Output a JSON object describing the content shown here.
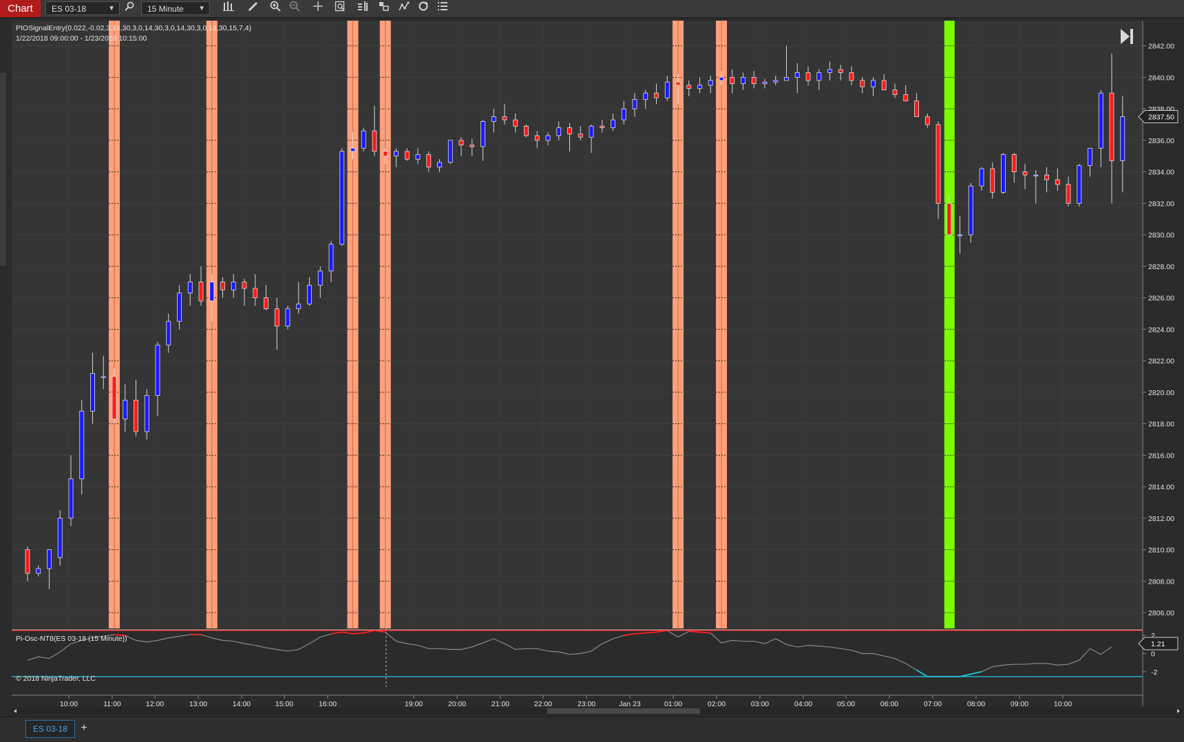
{
  "toolbar": {
    "chart_label": "Chart",
    "instrument": "ES 03-18",
    "interval": "15 Minute",
    "icons": [
      "search-icon",
      "bar-type-icon",
      "draw-pencil-icon",
      "zoom-in-icon",
      "zoom-out-icon",
      "crosshair-icon",
      "data-box-icon",
      "chart-trader-icon",
      "indicators-icon",
      "strategies-icon",
      "reload-icon",
      "properties-icon"
    ]
  },
  "chart": {
    "indicator_label": "PIOSignalEntry(0.022,-0.02,3,14,30,3,0,14,30,3,0,14,30,3,0,14,30,15,7,4)",
    "date_range": "1/22/2018 09:00:00 - 1/23/2018 10:15:00",
    "osc_label": "Pi-Osc-NT8(ES 03-18 (15 Minute))",
    "copyright": "© 2018 NinjaTrader, LLC",
    "current_price": "2837.50",
    "osc_value": "1.21",
    "colors": {
      "up": "#1a1aff",
      "down": "#ff1a1a",
      "short_band": "#ffa07a",
      "long_band": "#7cfc00",
      "osc_top": "#ff2020",
      "osc_bottom": "#22c8e6",
      "osc_line": "#8a8a8a"
    }
  },
  "tabs": {
    "active": "ES 03-18",
    "add": "+"
  },
  "chart_data": {
    "type": "candlestick",
    "price_axis": {
      "range": [
        2805,
        2843.6
      ],
      "ticks": [
        "2806.00",
        "2808.00",
        "2810.00",
        "2812.00",
        "2814.00",
        "2816.00",
        "2818.00",
        "2820.00",
        "2822.00",
        "2824.00",
        "2826.00",
        "2828.00",
        "2830.00",
        "2832.00",
        "2834.00",
        "2836.00",
        "2838.00",
        "2840.00",
        "2842.00"
      ]
    },
    "osc_axis": {
      "ticks": [
        "2",
        "0",
        "-2"
      ]
    },
    "time_ticks": [
      "10:00",
      "11:00",
      "12:00",
      "13:00",
      "14:00",
      "15:00",
      "16:00",
      "19:00",
      "20:00",
      "21:00",
      "22:00",
      "23:00",
      "Jan 23",
      "01:00",
      "02:00",
      "03:00",
      "04:00",
      "05:00",
      "06:00",
      "07:00",
      "08:00",
      "09:00",
      "10:00"
    ],
    "candles": [
      [
        2810.0,
        2810.2,
        2808.0,
        2808.5
      ],
      [
        2808.5,
        2809.0,
        2808.3,
        2808.8
      ],
      [
        2808.8,
        2810.0,
        2807.5,
        2810.0
      ],
      [
        2809.5,
        2812.5,
        2809.0,
        2812.0
      ],
      [
        2812.0,
        2816.0,
        2811.5,
        2814.5
      ],
      [
        2814.5,
        2819.5,
        2813.5,
        2818.8
      ],
      [
        2818.8,
        2822.5,
        2818.0,
        2821.2
      ],
      [
        2821.0,
        2822.3,
        2820.2,
        2821.0
      ],
      [
        2821.0,
        2821.5,
        2818.0,
        2818.3
      ],
      [
        2818.3,
        2820.5,
        2817.5,
        2819.5
      ],
      [
        2819.5,
        2820.8,
        2817.2,
        2817.5
      ],
      [
        2817.5,
        2820.2,
        2817.0,
        2819.8
      ],
      [
        2819.8,
        2823.2,
        2818.5,
        2823.0
      ],
      [
        2823.0,
        2825.0,
        2822.5,
        2824.5
      ],
      [
        2824.5,
        2826.8,
        2824.0,
        2826.3
      ],
      [
        2826.3,
        2827.5,
        2825.5,
        2827.0
      ],
      [
        2827.0,
        2828.0,
        2825.5,
        2825.8
      ],
      [
        2825.8,
        2827.5,
        2824.5,
        2827.0
      ],
      [
        2827.0,
        2827.3,
        2826.0,
        2826.5
      ],
      [
        2826.5,
        2827.5,
        2826.0,
        2827.0
      ],
      [
        2827.0,
        2827.2,
        2825.5,
        2826.6
      ],
      [
        2826.6,
        2827.5,
        2825.5,
        2826.0
      ],
      [
        2826.0,
        2826.8,
        2825.2,
        2825.3
      ],
      [
        2825.3,
        2826.0,
        2822.7,
        2824.2
      ],
      [
        2824.2,
        2825.5,
        2824.0,
        2825.3
      ],
      [
        2825.3,
        2827.0,
        2825.0,
        2825.6
      ],
      [
        2825.6,
        2827.3,
        2825.5,
        2826.8
      ],
      [
        2826.8,
        2828.0,
        2826.0,
        2827.7
      ],
      [
        2827.7,
        2829.6,
        2827.0,
        2829.4
      ],
      [
        2829.4,
        2835.5,
        2829.3,
        2835.3
      ],
      [
        2835.3,
        2836.5,
        2834.8,
        2835.5
      ],
      [
        2835.5,
        2836.8,
        2835.3,
        2836.6
      ],
      [
        2836.6,
        2838.2,
        2835.0,
        2835.3
      ],
      [
        2835.3,
        2835.5,
        2834.5,
        2835.0
      ],
      [
        2835.0,
        2835.5,
        2834.3,
        2835.3
      ],
      [
        2835.3,
        2835.5,
        2834.7,
        2834.8
      ],
      [
        2834.8,
        2835.5,
        2834.5,
        2835.1
      ],
      [
        2835.1,
        2835.3,
        2834.0,
        2834.3
      ],
      [
        2834.3,
        2834.8,
        2834.0,
        2834.6
      ],
      [
        2834.6,
        2836.0,
        2834.5,
        2836.0
      ],
      [
        2836.0,
        2836.2,
        2835.0,
        2835.7
      ],
      [
        2835.7,
        2836.1,
        2835.0,
        2835.6
      ],
      [
        2835.6,
        2837.3,
        2834.7,
        2837.2
      ],
      [
        2837.2,
        2838.0,
        2836.5,
        2837.5
      ],
      [
        2837.5,
        2838.3,
        2837.0,
        2837.3
      ],
      [
        2837.3,
        2837.7,
        2836.5,
        2836.9
      ],
      [
        2836.9,
        2837.0,
        2836.2,
        2836.3
      ],
      [
        2836.3,
        2836.6,
        2835.5,
        2836.0
      ],
      [
        2836.0,
        2836.5,
        2835.7,
        2836.3
      ],
      [
        2836.3,
        2837.2,
        2836.0,
        2836.8
      ],
      [
        2836.8,
        2837.1,
        2835.3,
        2836.4
      ],
      [
        2836.4,
        2836.9,
        2836.0,
        2836.2
      ],
      [
        2836.2,
        2837.0,
        2835.2,
        2836.9
      ],
      [
        2836.9,
        2837.3,
        2836.5,
        2836.8
      ],
      [
        2836.8,
        2837.7,
        2836.6,
        2837.3
      ],
      [
        2837.3,
        2838.5,
        2837.0,
        2838.0
      ],
      [
        2838.0,
        2839.0,
        2837.5,
        2838.6
      ],
      [
        2838.6,
        2839.2,
        2838.0,
        2839.0
      ],
      [
        2839.0,
        2839.6,
        2838.3,
        2838.7
      ],
      [
        2838.7,
        2840.1,
        2838.5,
        2839.7
      ],
      [
        2839.7,
        2840.2,
        2838.3,
        2839.5
      ],
      [
        2839.5,
        2839.8,
        2838.8,
        2839.3
      ],
      [
        2839.3,
        2840.0,
        2839.0,
        2839.5
      ],
      [
        2839.5,
        2840.1,
        2839.0,
        2839.8
      ],
      [
        2839.8,
        2840.4,
        2839.5,
        2840.0
      ],
      [
        2840.0,
        2840.5,
        2839.0,
        2839.6
      ],
      [
        2839.6,
        2840.3,
        2839.2,
        2840.0
      ],
      [
        2840.0,
        2840.4,
        2839.3,
        2839.6
      ],
      [
        2839.6,
        2839.9,
        2839.3,
        2839.7
      ],
      [
        2839.7,
        2840.1,
        2839.5,
        2839.8
      ],
      [
        2839.8,
        2842.0,
        2839.8,
        2840.0
      ],
      [
        2840.0,
        2840.9,
        2839.0,
        2840.3
      ],
      [
        2840.3,
        2840.7,
        2839.5,
        2839.8
      ],
      [
        2839.8,
        2840.5,
        2839.2,
        2840.3
      ],
      [
        2840.3,
        2841.0,
        2839.8,
        2840.5
      ],
      [
        2840.5,
        2840.8,
        2839.8,
        2840.3
      ],
      [
        2840.3,
        2840.7,
        2839.5,
        2839.8
      ],
      [
        2839.8,
        2840.0,
        2839.0,
        2839.4
      ],
      [
        2839.4,
        2840.0,
        2838.8,
        2839.8
      ],
      [
        2839.8,
        2840.2,
        2839.2,
        2839.2
      ],
      [
        2839.2,
        2839.6,
        2838.7,
        2838.9
      ],
      [
        2838.9,
        2839.5,
        2838.5,
        2838.5
      ],
      [
        2838.5,
        2839.0,
        2837.5,
        2837.5
      ],
      [
        2837.5,
        2837.7,
        2836.8,
        2837.0
      ],
      [
        2837.0,
        2837.2,
        2831.0,
        2832.0
      ],
      [
        2832.0,
        2832.5,
        2829.8,
        2830.0
      ],
      [
        2830.0,
        2831.2,
        2828.8,
        2830.0
      ],
      [
        2830.0,
        2833.3,
        2829.5,
        2833.1
      ],
      [
        2833.1,
        2834.3,
        2832.8,
        2834.2
      ],
      [
        2834.2,
        2834.6,
        2832.3,
        2832.7
      ],
      [
        2832.7,
        2835.2,
        2832.6,
        2835.1
      ],
      [
        2835.1,
        2835.2,
        2833.3,
        2834.0
      ],
      [
        2834.0,
        2834.5,
        2832.9,
        2833.8
      ],
      [
        2833.8,
        2834.1,
        2832.0,
        2833.8
      ],
      [
        2833.8,
        2834.3,
        2832.7,
        2833.5
      ],
      [
        2833.5,
        2834.2,
        2832.8,
        2833.2
      ],
      [
        2833.2,
        2833.7,
        2831.8,
        2832.0
      ],
      [
        2832.0,
        2834.5,
        2831.8,
        2834.4
      ],
      [
        2834.4,
        2835.5,
        2833.7,
        2835.5
      ],
      [
        2835.5,
        2839.2,
        2834.3,
        2839.0
      ],
      [
        2839.0,
        2841.5,
        2832.0,
        2834.7
      ],
      [
        2834.7,
        2838.8,
        2832.7,
        2837.5
      ]
    ],
    "short_signal_bars": [
      8,
      17,
      30,
      33,
      60,
      64
    ],
    "long_signal_bars": [
      85
    ],
    "oscillator": [
      -0.8,
      -0.4,
      -0.6,
      0.2,
      1.2,
      1.6,
      1.9,
      2.1,
      2.3,
      2.2,
      1.6,
      1.4,
      1.6,
      1.9,
      2.1,
      2.3,
      2.3,
      1.9,
      1.6,
      1.5,
      1.2,
      1.0,
      0.7,
      0.5,
      0.3,
      0.5,
      1.2,
      2.0,
      2.4,
      2.6,
      2.4,
      2.5,
      2.8,
      2.6,
      1.5,
      1.2,
      1.0,
      0.6,
      0.6,
      0.5,
      0.5,
      0.8,
      1.3,
      1.8,
      1.2,
      0.5,
      0.6,
      0.6,
      0.3,
      0.2,
      -0.1,
      0.0,
      0.3,
      1.2,
      1.8,
      2.2,
      2.4,
      2.5,
      2.6,
      2.8,
      2.0,
      2.7,
      2.6,
      2.5,
      1.3,
      1.6,
      1.5,
      1.5,
      1.2,
      1.8,
      1.1,
      0.8,
      1.0,
      0.9,
      0.8,
      0.6,
      0.4,
      0.0,
      0.0,
      -0.3,
      -0.6,
      -1.2,
      -2.0,
      -2.8,
      -2.8,
      -2.8,
      -2.8,
      -2.5,
      -2.2,
      -1.6,
      -1.4,
      -1.3,
      -1.3,
      -1.2,
      -1.2,
      -1.4,
      -1.3,
      -0.8,
      0.6,
      -0.1,
      0.8
    ]
  }
}
